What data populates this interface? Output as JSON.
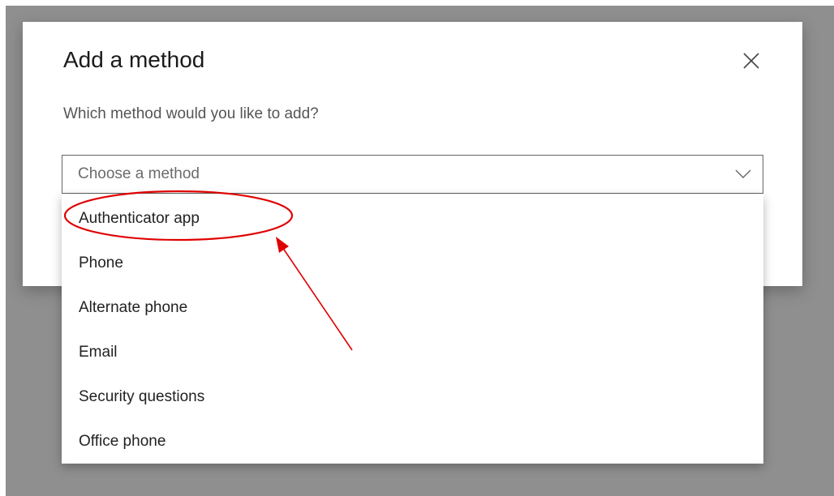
{
  "dialog": {
    "title": "Add a method",
    "prompt": "Which method would you like to add?",
    "close_icon": "close-icon"
  },
  "select": {
    "placeholder": "Choose a method",
    "chevron_icon": "chevron-down-icon"
  },
  "dropdown": {
    "options": [
      {
        "label": "Authenticator app"
      },
      {
        "label": "Phone"
      },
      {
        "label": "Alternate phone"
      },
      {
        "label": "Email"
      },
      {
        "label": "Security questions"
      },
      {
        "label": "Office phone"
      }
    ]
  },
  "annotation": {
    "color": "#e00000",
    "highlighted_option": "Authenticator app"
  },
  "colors": {
    "overlay": "#8f8f8f",
    "dialog_bg": "#ffffff",
    "text": "#1b1b1b",
    "muted_text": "#555555"
  }
}
